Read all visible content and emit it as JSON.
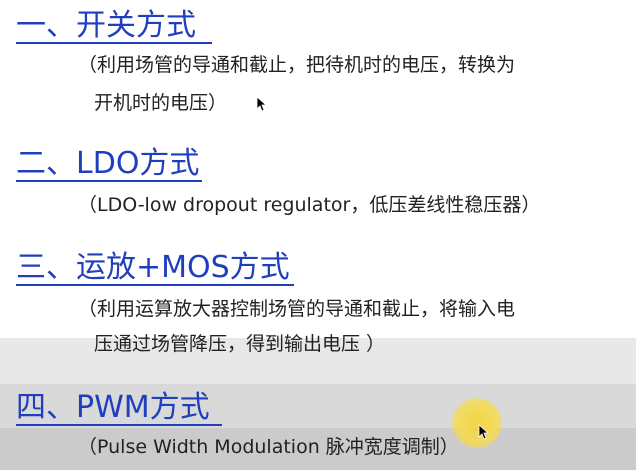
{
  "top_fragment": "",
  "sections": [
    {
      "title": "一、开关方式",
      "desc_lines": [
        "（利用场管的导通和截止，把待机时的电压，转换为",
        "开机时的电压）"
      ]
    },
    {
      "title": "二、LDO方式",
      "desc_lines": [
        "（LDO-low dropout regulator，低压差线性稳压器）"
      ]
    },
    {
      "title": "三、运放+MOS方式",
      "desc_lines": [
        "（利用运算放大器控制场管的导通和截止，将输入电",
        "压通过场管降压，得到输出电压 ）"
      ]
    },
    {
      "title": "四、PWM方式",
      "desc_lines": [
        "（Pulse Width Modulation 脉冲宽度调制）"
      ]
    }
  ],
  "colors": {
    "heading": "#1f3fbf",
    "text": "#222222",
    "highlight": "#f4d438"
  }
}
